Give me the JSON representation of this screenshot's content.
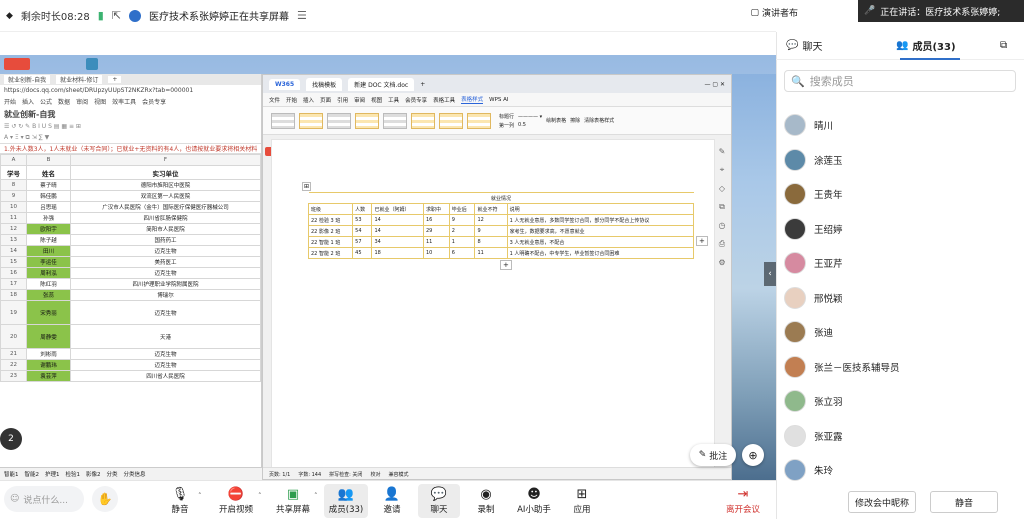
{
  "topbar": {
    "remaining": "剩余时长08:28",
    "share_title": "医疗技术系张婷婷正在共享屏幕",
    "presenter": "演讲者布",
    "speaking": "正在讲话：医疗技术系张婷婷;"
  },
  "sheet": {
    "tab_title": "就业创新-自我",
    "tab2": "就业材料-修订",
    "url": "https://docs.qq.com/sheet/DRUpzyUUpST2NKZRx?tab=000001",
    "menu": [
      "开始",
      "插入",
      "公式",
      "数据",
      "审阅",
      "视图",
      "效率工具",
      "会员专享"
    ],
    "doc_name": "就业创新-自我",
    "note": "1.外未人数3人，1人未就业（未写合同）；已就业+无资料的有4人，也请按就业要求将相关材料",
    "col_header": [
      "A",
      "B",
      "F"
    ],
    "header": [
      "学号",
      "姓名",
      "实习单位"
    ],
    "rows": [
      {
        "n": "8",
        "name": "蔡子晴",
        "unit": "德阳市旌阳区中医院",
        "g": false
      },
      {
        "n": "9",
        "name": "韩佳鹏",
        "unit": "双流区第一人民医院",
        "g": false
      },
      {
        "n": "10",
        "name": "吕思瑶",
        "unit": "广汉市人民医院（金牛）国际医疗保健医疗器械公司",
        "g": false
      },
      {
        "n": "11",
        "name": "孙强",
        "unit": "四川省肛肠保健院",
        "g": false
      },
      {
        "n": "12",
        "name": "欧阳宇",
        "unit": "简阳市人民医院",
        "g": true
      },
      {
        "n": "13",
        "name": "陈子越",
        "unit": "国药药工",
        "g": false
      },
      {
        "n": "14",
        "name": "田川",
        "unit": "迈克生物",
        "g": true
      },
      {
        "n": "15",
        "name": "李运佳",
        "unit": "美药医工",
        "g": true
      },
      {
        "n": "16",
        "name": "周利泓",
        "unit": "迈克生物",
        "g": true
      },
      {
        "n": "17",
        "name": "陈红羽",
        "unit": "四川护理职业学院附属医院",
        "g": false
      },
      {
        "n": "18",
        "name": "张蕊",
        "unit": "博瑞尔",
        "g": true
      },
      {
        "n": "19",
        "name": "宋秀丽",
        "unit": "迈克生物",
        "g": true
      },
      {
        "n": "20",
        "name": "周静雯",
        "unit": "天港",
        "g": true
      },
      {
        "n": "21",
        "name": "刘彬雨",
        "unit": "迈克生物",
        "g": false
      },
      {
        "n": "22",
        "name": "谢鹏玮",
        "unit": "迈克生物",
        "g": true
      },
      {
        "n": "23",
        "name": "袁芸萍",
        "unit": "四川省人民医院",
        "g": true
      }
    ],
    "sheet_tabs": [
      "智能1",
      "智能2",
      "护理1",
      "检验1",
      "影像2",
      "分类",
      "分类信息"
    ]
  },
  "doc": {
    "tabs": [
      "W365",
      "找稿模板",
      "新建 DOC 文档.doc"
    ],
    "menu": [
      "文件",
      "开始",
      "插入",
      "页面",
      "引用",
      "审阅",
      "视图",
      "工具",
      "会员专享",
      "表格工具",
      "表格样式",
      "WPS AI"
    ],
    "active_menu": "表格样式",
    "ribbon_labels": [
      "标题行",
      "第一列",
      "边框",
      "0.5",
      "绘制表格",
      "擦除",
      "清除表格样式"
    ],
    "table": {
      "title": "就业情况",
      "header": [
        "班级",
        "人数",
        "已就业（阿姆）",
        "求职中",
        "毕业后",
        "就业不符",
        "说明"
      ],
      "rows": [
        [
          "22 检验 3 班",
          "53",
          "14",
          "16",
          "9",
          "12",
          "1 人无就业意愿，多数同学签订合同，部分同学不配合上传协议"
        ],
        [
          "22 影像 2 班",
          "54",
          "14",
          "29",
          "2",
          "9",
          "家考生，数据要求高，不愿意就业"
        ],
        [
          "22 智能 1 班",
          "57",
          "34",
          "11",
          "1",
          "8",
          "3 人无就业意愿，不配合"
        ],
        [
          "22 智能 2 班",
          "45",
          "18",
          "10",
          "6",
          "11",
          "1 人明确不配合，中专学生，毕业暂签订合同困难"
        ]
      ]
    },
    "status": [
      "页数: 1/1",
      "字数: 144",
      "拼写检查: 关闭",
      "校对",
      "兼容模式"
    ]
  },
  "stage": {
    "annotate": "批注"
  },
  "bottombar": {
    "chat_placeholder": "说点什么...",
    "buttons": [
      "静音",
      "开启视频",
      "共享屏幕",
      "成员(33)",
      "邀请",
      "聊天",
      "录制",
      "AI小助手",
      "应用"
    ],
    "leave": "离开会议"
  },
  "panel": {
    "tab_chat": "聊天",
    "tab_members": "成员(33)",
    "search_placeholder": "搜索成员",
    "members": [
      "晴川",
      "涂莲玉",
      "王贵年",
      "王绍婷",
      "王亚芹",
      "邢悦颖",
      "张迪",
      "张兰－医技系辅导员",
      "张立羽",
      "张亚露",
      "朱玲"
    ],
    "member_colors": [
      "#a7b9c9",
      "#5d8aa8",
      "#8a6a3c",
      "#3b3b3b",
      "#d68aa0",
      "#e8d0c0",
      "#9b7b52",
      "#c27f52",
      "#8fb98c",
      "#e0e0e0",
      "#7fa1c4"
    ],
    "rename": "修改会中昵称",
    "mute_all": "静音"
  }
}
